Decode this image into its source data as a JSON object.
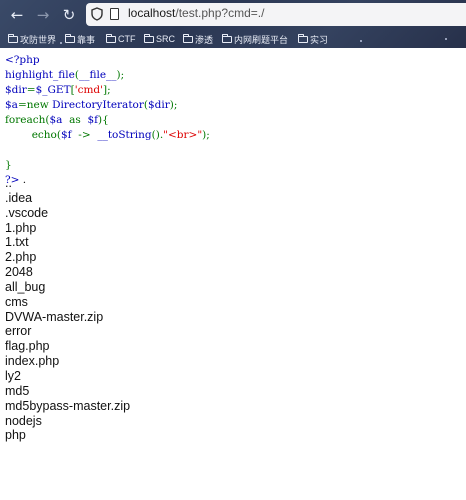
{
  "browser": {
    "url_host": "localhost",
    "url_path": "/test.php?cmd=./",
    "bookmarks": [
      "攻防世界",
      "靠事",
      "CTF",
      "SRC",
      "渗透",
      "内网刷题平台",
      "实习"
    ]
  },
  "code": {
    "open_tag": "<?php",
    "l2_fn": "highlight_file",
    "l2_arg": "__file__",
    "l3_var": "$dir",
    "l3_get": "$_GET",
    "l3_key": "'cmd'",
    "l4_var": "$a",
    "l4_new": "new",
    "l4_cls": "DirectoryIterator",
    "l4_arg": "$dir",
    "l5_kw": "foreach",
    "l5_a": "$a",
    "l5_as": "as",
    "l5_f": "$f",
    "l6_echo": "echo",
    "l6_f": "$f",
    "l6_arrow": "->",
    "l6_method": "__toString",
    "l6_br": "\"<br>\"",
    "close_brace": "}",
    "close_tag": "?>",
    "dot": "."
  },
  "listing": [
    "..",
    ".idea",
    ".vscode",
    "1.php",
    "1.txt",
    "2.php",
    "2048",
    "all_bug",
    "cms",
    "DVWA-master.zip",
    "error",
    "flag.php",
    "index.php",
    "ly2",
    "md5",
    "md5bypass-master.zip",
    "nodejs",
    "php"
  ]
}
